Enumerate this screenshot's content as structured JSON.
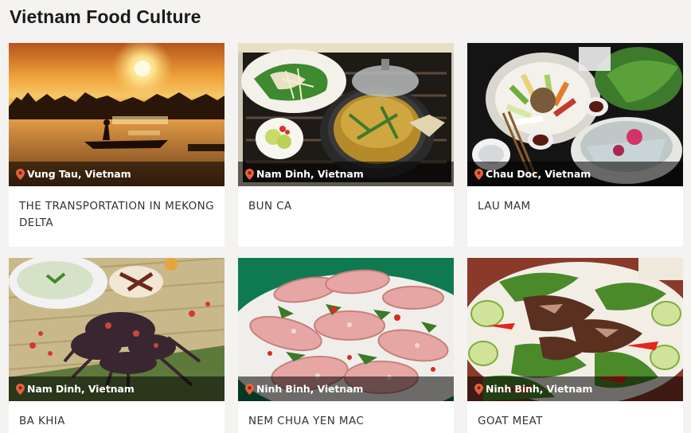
{
  "page": {
    "title": "Vietnam Food Culture"
  },
  "cards": [
    {
      "title": "THE TRANSPORTATION IN MEKONG DELTA",
      "location": "Vung Tau, Vietnam",
      "image": "sunset-boat-river"
    },
    {
      "title": "BUN CA",
      "location": "Nam Dinh, Vietnam",
      "image": "fish-noodle-soup-hotpot"
    },
    {
      "title": "LAU MAM",
      "location": "Chau Doc, Vietnam",
      "image": "fermented-fish-hotpot-spread"
    },
    {
      "title": "BA KHIA",
      "location": "Nam Dinh, Vietnam",
      "image": "salted-crabs-with-porridge"
    },
    {
      "title": "NEM CHUA YEN MAC",
      "location": "Ninh Binh, Vietnam",
      "image": "fermented-pork-rolls"
    },
    {
      "title": "GOAT MEAT",
      "location": "Ninh Binh, Vietnam",
      "image": "goat-meat-salad"
    }
  ],
  "colors": {
    "pin": "#e8603c",
    "overlay": "rgba(0,0,0,0.55)",
    "background": "#f4f3f1"
  },
  "icons": {
    "location": "map-pin-icon"
  }
}
